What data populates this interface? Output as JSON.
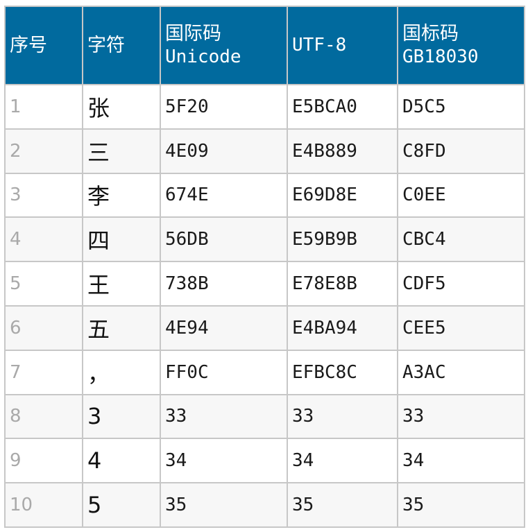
{
  "headers": {
    "index": "序号",
    "char": "字符",
    "unicode_line1": "国际码",
    "unicode_line2": "Unicode",
    "utf8": "UTF-8",
    "gb_line1": "国标码",
    "gb_line2": "GB18030"
  },
  "rows": [
    {
      "index": "1",
      "char": "张",
      "unicode": "5F20",
      "utf8": "E5BCA0",
      "gb": "D5C5"
    },
    {
      "index": "2",
      "char": "三",
      "unicode": "4E09",
      "utf8": "E4B889",
      "gb": "C8FD"
    },
    {
      "index": "3",
      "char": "李",
      "unicode": "674E",
      "utf8": "E69D8E",
      "gb": "C0EE"
    },
    {
      "index": "4",
      "char": "四",
      "unicode": "56DB",
      "utf8": "E59B9B",
      "gb": "CBC4"
    },
    {
      "index": "5",
      "char": "王",
      "unicode": "738B",
      "utf8": "E78E8B",
      "gb": "CDF5"
    },
    {
      "index": "6",
      "char": "五",
      "unicode": "4E94",
      "utf8": "E4BA94",
      "gb": "CEE5"
    },
    {
      "index": "7",
      "char": "，",
      "unicode": "FF0C",
      "utf8": "EFBC8C",
      "gb": "A3AC"
    },
    {
      "index": "8",
      "char": "3",
      "unicode": "33",
      "utf8": "33",
      "gb": "33"
    },
    {
      "index": "9",
      "char": "4",
      "unicode": "34",
      "utf8": "34",
      "gb": "34"
    },
    {
      "index": "10",
      "char": "5",
      "unicode": "35",
      "utf8": "35",
      "gb": "35"
    }
  ],
  "colors": {
    "header_bg": "#016a9e",
    "header_text": "#ffffff",
    "border": "#c7c7c7",
    "index_text": "#a9a9a9"
  }
}
